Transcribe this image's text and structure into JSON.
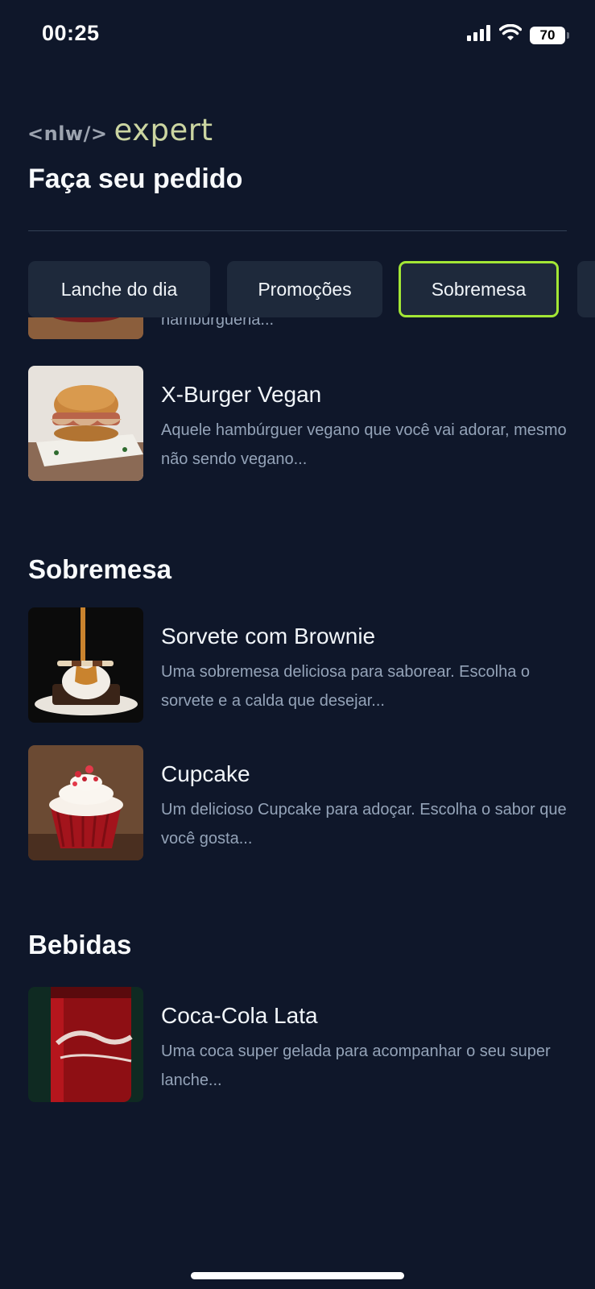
{
  "status_bar": {
    "time": "00:25",
    "battery": "70",
    "icons": [
      "signal-icon",
      "wifi-icon",
      "battery-icon"
    ]
  },
  "header": {
    "logo_prefix": "<nlw/>",
    "logo_word": "expert",
    "title": "Faça seu pedido"
  },
  "tabs": [
    {
      "label": "Lanche do dia",
      "active": false
    },
    {
      "label": "Promoções",
      "active": false
    },
    {
      "label": "Sobremesa",
      "active": true
    }
  ],
  "partial_item": {
    "desc": "hamburgueria..."
  },
  "items": {
    "xburger": {
      "title": "X-Burger Vegan",
      "desc": "Aquele hambúrguer vegano que você vai adorar, mesmo não sendo vegano..."
    },
    "sorvete": {
      "title": "Sorvete com Brownie",
      "desc": "Uma sobremesa deliciosa para saborear. Escolha o sorvete e a calda que desejar..."
    },
    "cupcake": {
      "title": "Cupcake",
      "desc": "Um delicioso Cupcake para adoçar. Escolha o sabor que você gosta..."
    },
    "coca": {
      "title": "Coca-Cola Lata",
      "desc": "Uma coca super gelada para acompanhar o seu super lanche..."
    }
  },
  "sections": {
    "sobremesa": "Sobremesa",
    "bebidas": "Bebidas"
  },
  "colors": {
    "background": "#0f172a",
    "card": "#1e293b",
    "accent": "#a3e635",
    "muted_text": "#94a3b8"
  }
}
